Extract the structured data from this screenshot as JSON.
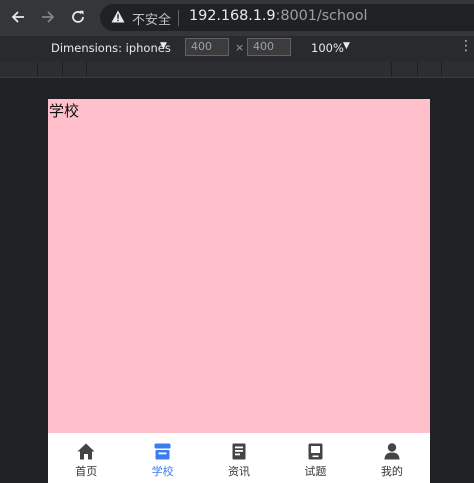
{
  "browser": {
    "insecure_label": "不安全",
    "url_host": "192.168.1.9",
    "url_rest": ":8001/school"
  },
  "device_toolbar": {
    "dimensions_label": "Dimensions: iphones",
    "width": "400",
    "height": "400",
    "times": "×",
    "zoom": "100%"
  },
  "page": {
    "title": "学校",
    "background": "#ffc0cb"
  },
  "tabbar": {
    "active_color": "#3b7cf0",
    "items": [
      {
        "label": "首页",
        "icon": "home-icon"
      },
      {
        "label": "学校",
        "icon": "store-icon"
      },
      {
        "label": "资讯",
        "icon": "document-icon"
      },
      {
        "label": "试题",
        "icon": "book-icon"
      },
      {
        "label": "我的",
        "icon": "user-icon"
      }
    ]
  }
}
